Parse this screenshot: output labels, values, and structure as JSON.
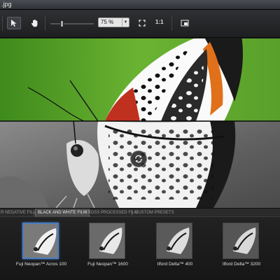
{
  "window": {
    "title_fragment": ".jpg"
  },
  "toolbar": {
    "zoom_value": "75 %",
    "one_to_one_label": "1:1"
  },
  "film_tabs": [
    {
      "label": "R NEGATIVE FILM",
      "active": false
    },
    {
      "label": "BLACK AND WHITE FILM",
      "active": true
    },
    {
      "label": "CROSS PROCESSED FILM",
      "active": false
    },
    {
      "label": "CUSTOM PRESETS",
      "active": false
    }
  ],
  "presets": [
    {
      "label": "Fuji Neopan™ Acros 100",
      "selected": true
    },
    {
      "label": "Fuji Neopan™ 1600",
      "selected": false
    },
    {
      "label": "Ilford Delta™ 400",
      "selected": false
    },
    {
      "label": "Ilford Delta™ 3200",
      "selected": false
    }
  ],
  "colors": {
    "accent": "#4a7dbf",
    "bg": "#1b1b1b",
    "leaf_green": "#5aa12a",
    "wing_orange": "#e0701a"
  },
  "icons": [
    "arrow-pointer-icon",
    "hand-icon",
    "fit-screen-icon",
    "one-to-one-icon",
    "compare-view-icon",
    "swap-rotate-icon"
  ]
}
